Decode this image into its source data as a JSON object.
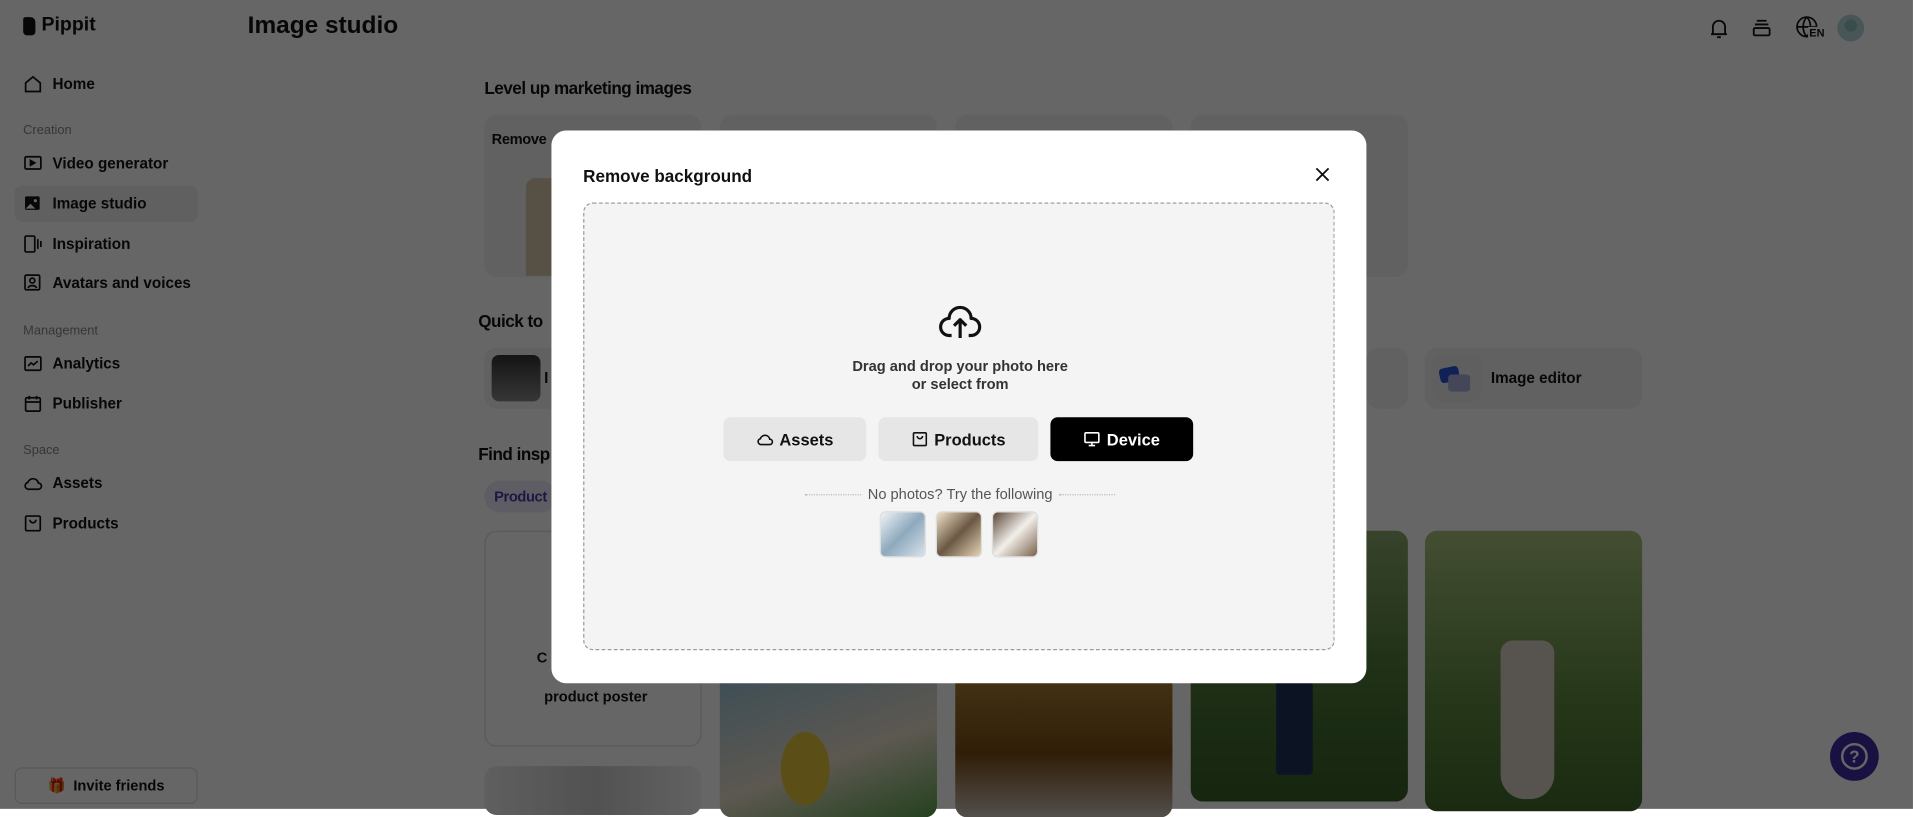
{
  "app": {
    "name": "Pippit",
    "page_title": "Image studio"
  },
  "sidebar": {
    "items": [
      {
        "label": "Home"
      },
      {
        "section": "Creation"
      },
      {
        "label": "Video generator"
      },
      {
        "label": "Image studio"
      },
      {
        "label": "Inspiration"
      },
      {
        "label": "Avatars and voices"
      },
      {
        "section": "Management"
      },
      {
        "label": "Analytics"
      },
      {
        "label": "Publisher"
      },
      {
        "section": "Space"
      },
      {
        "label": "Assets"
      },
      {
        "label": "Products"
      }
    ],
    "invite_label": "Invite friends"
  },
  "header": {
    "language": "EN"
  },
  "main": {
    "section1_title": "Level up marketing images",
    "card1_label": "Remove",
    "section2_title": "Quick to",
    "quick_tool_first": "I",
    "quick_tool_last": "Image editor",
    "section3_title": "Find insp",
    "filter_pill": "Product",
    "poster_card_line1": "C",
    "poster_card_line2": "product poster"
  },
  "modal": {
    "title": "Remove background",
    "drop_line1": "Drag and drop your photo here",
    "drop_line2": "or select from",
    "buttons": {
      "assets": "Assets",
      "products": "Products",
      "device": "Device"
    },
    "try_text": "No photos? Try the following"
  },
  "colors": {
    "accent": "#3b2aa6",
    "primary_button": "#000000"
  }
}
